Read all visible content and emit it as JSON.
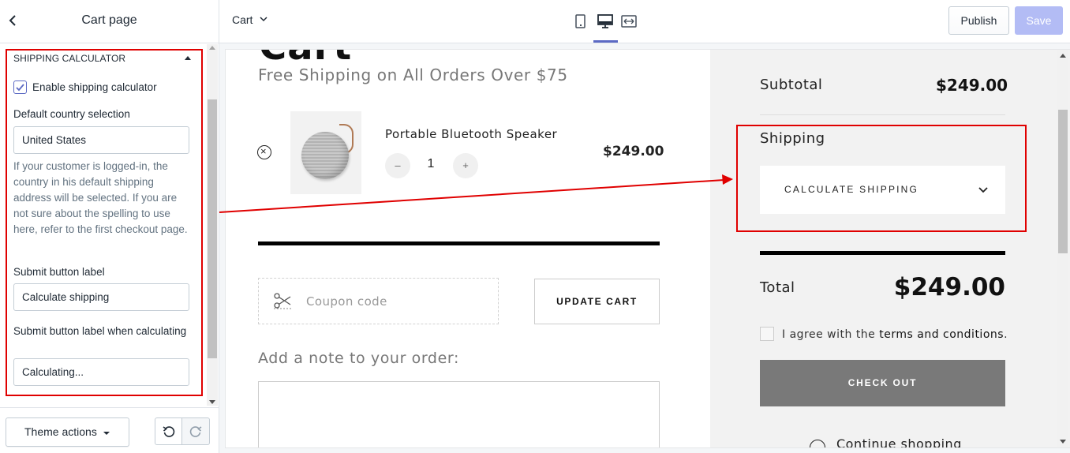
{
  "panel": {
    "title": "Cart page",
    "section_title": "SHIPPING CALCULATOR",
    "enable_label": "Enable shipping calculator",
    "enable_checked": true,
    "country_label": "Default country selection",
    "country_value": "United States",
    "help_text": "If your customer is logged-in, the country in his default shipping address will be selected. If you are not sure about the spelling to use here, refer to the first checkout page.",
    "submit_label": "Submit button label",
    "submit_value": "Calculate shipping",
    "calculating_label": "Submit button label when calculating",
    "calculating_value": "Calculating...",
    "theme_actions": "Theme actions"
  },
  "topbar": {
    "page_select": "Cart",
    "publish": "Publish",
    "save": "Save",
    "active_device": "desktop"
  },
  "preview": {
    "free_shipping": "Free Shipping on All Orders Over $75",
    "product": {
      "name": "Portable Bluetooth Speaker",
      "quantity": "1",
      "price": "$249.00",
      "minus": "–",
      "plus": "+"
    },
    "coupon_placeholder": "Coupon code",
    "update_cart": "UPDATE CART",
    "note_label": "Add a note to your order:",
    "summary": {
      "subtotal_label": "Subtotal",
      "subtotal_value": "$249.00",
      "shipping_label": "Shipping",
      "calculate_shipping": "CALCULATE SHIPPING",
      "total_label": "Total",
      "total_value": "$249.00",
      "agree_prefix": "I agree with the ",
      "agree_link": "terms and conditions",
      "agree_suffix": ".",
      "checkout": "CHECK OUT",
      "continue": "Continue shopping"
    }
  },
  "colors": {
    "accent": "#5c6ac4",
    "save_disabled": "#b3bcf5",
    "annotation": "#e00000",
    "checkout_bg": "#797979"
  },
  "icons": {
    "back": "chevron-left-icon",
    "mobile": "mobile-icon",
    "desktop": "desktop-icon",
    "fullscreen": "fullscreen-icon",
    "coupon": "scissors-icon",
    "undo": "undo-icon",
    "redo": "redo-icon"
  }
}
